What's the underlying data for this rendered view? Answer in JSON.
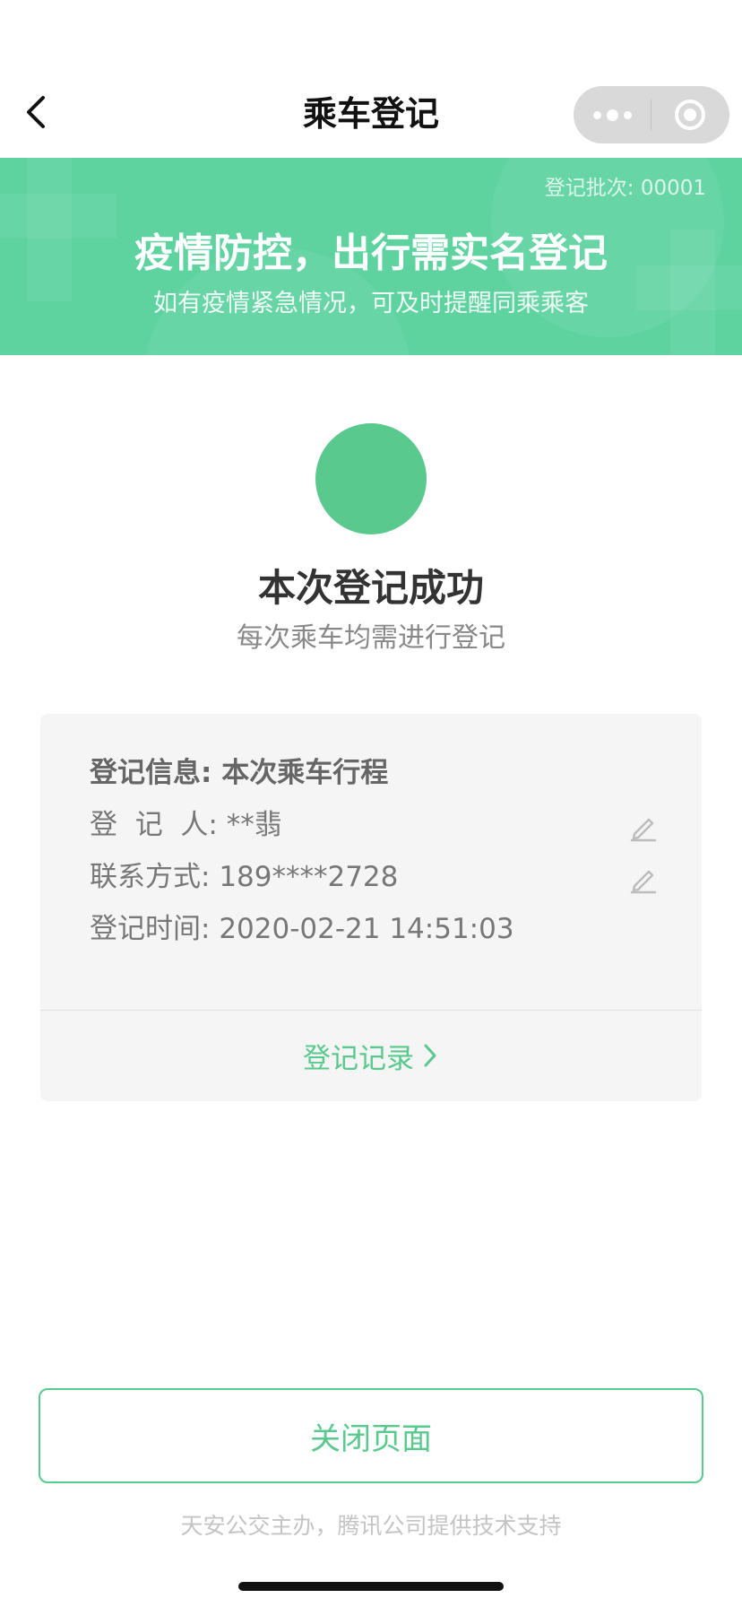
{
  "header": {
    "title": "乘车登记",
    "back_icon": "chevron-left-icon",
    "capsule_more_icon": "more-dots-icon",
    "capsule_close_icon": "target-icon"
  },
  "banner": {
    "batch_label": "登记批次: 00001",
    "title": "疫情防控，出行需实名登记",
    "subtitle": "如有疫情紧急情况，可及时提醒同乘乘客",
    "color": "#5ed3a0"
  },
  "status": {
    "icon": "success-circle",
    "title": "本次登记成功",
    "subtitle": "每次乘车均需进行登记",
    "color": "#5ac98e"
  },
  "info_card": {
    "rows": [
      {
        "label": "登记信息: ",
        "value": "本次乘车行程"
      },
      {
        "label": "登  记  人: ",
        "value": "**翡"
      },
      {
        "label": "联系方式: ",
        "value": "189****2728"
      },
      {
        "label": "登记时间: ",
        "value": "2020-02-21 14:51:03"
      }
    ],
    "edit_icon": "pencil-icon",
    "records_link": "登记记录"
  },
  "actions": {
    "close_label": "关闭页面"
  },
  "footer": {
    "text": "天安公交主办，腾讯公司提供技术支持"
  }
}
